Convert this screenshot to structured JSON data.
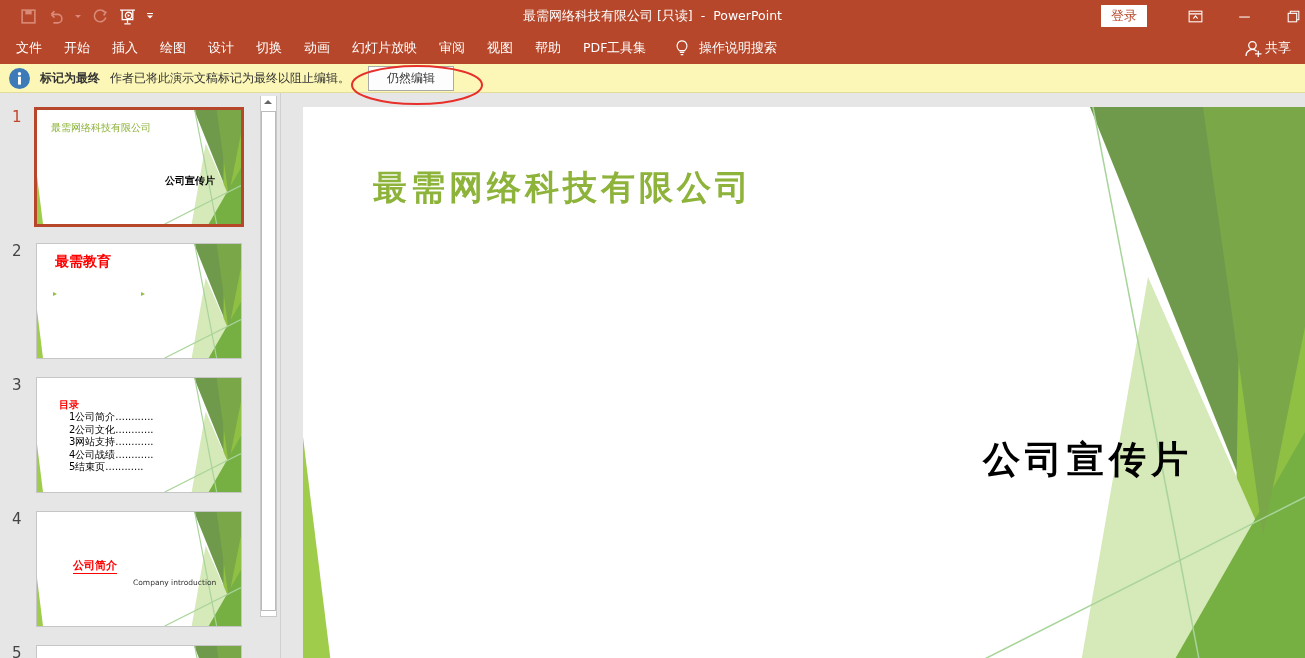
{
  "window": {
    "title": "最需网络科技有限公司 [只读]  -  PowerPoint",
    "sign_in": "登录"
  },
  "ribbon_tabs": [
    {
      "label": "文件",
      "selected": false
    },
    {
      "label": "开始",
      "selected": false
    },
    {
      "label": "插入",
      "selected": false
    },
    {
      "label": "绘图",
      "selected": false
    },
    {
      "label": "设计",
      "selected": false
    },
    {
      "label": "切换",
      "selected": false
    },
    {
      "label": "动画",
      "selected": false
    },
    {
      "label": "幻灯片放映",
      "selected": false
    },
    {
      "label": "审阅",
      "selected": false
    },
    {
      "label": "视图",
      "selected": false
    },
    {
      "label": "帮助",
      "selected": false
    },
    {
      "label": "PDF工具集",
      "selected": false
    }
  ],
  "tell_me": "操作说明搜索",
  "share": "共享",
  "message_bar": {
    "title": "标记为最终",
    "text": "作者已将此演示文稿标记为最终以阻止编辑。",
    "button": "仍然编辑"
  },
  "slides": [
    {
      "number": "1",
      "selected": true,
      "kind": "title",
      "title": "最需网络科技有限公司",
      "subtitle": "公司宣传片"
    },
    {
      "number": "2",
      "selected": false,
      "kind": "heading",
      "title": "最需教育"
    },
    {
      "number": "3",
      "selected": false,
      "kind": "list",
      "title": "目录",
      "items": [
        "1公司简介............",
        "2公司文化............",
        "3网站支持............",
        "4公司战绩............",
        "5结束页............"
      ]
    },
    {
      "number": "4",
      "selected": false,
      "kind": "section",
      "title": "公司简介",
      "subtitle": "Company  introduction"
    },
    {
      "number": "5",
      "selected": false,
      "kind": "cut"
    }
  ],
  "current_slide": {
    "title": "最需网络科技有限公司",
    "subtitle": "公司宣传片"
  }
}
